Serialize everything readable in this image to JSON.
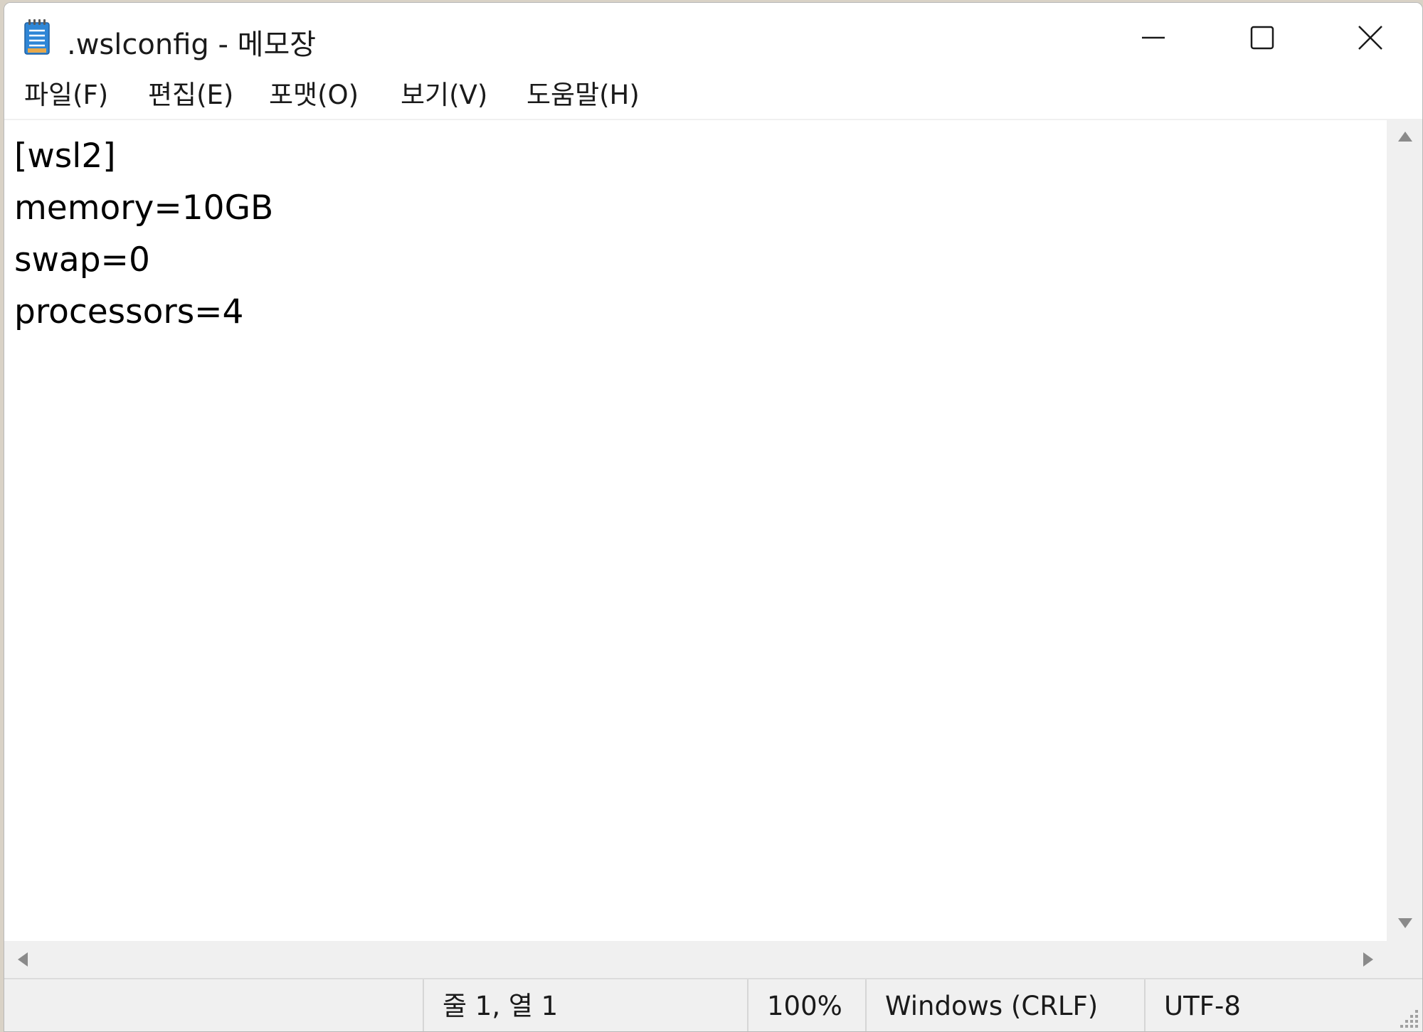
{
  "window": {
    "title": ".wslconfig - 메모장",
    "controls": {
      "minimize_icon": "minimize-icon",
      "maximize_icon": "maximize-icon",
      "close_icon": "close-icon"
    }
  },
  "menu": {
    "items": [
      {
        "label": "파일(F)"
      },
      {
        "label": "편집(E)"
      },
      {
        "label": "포맷(O)"
      },
      {
        "label": "보기(V)"
      },
      {
        "label": "도움말(H)"
      }
    ]
  },
  "editor": {
    "lines": [
      "[wsl2]",
      "memory=10GB",
      "swap=0",
      "processors=4"
    ]
  },
  "status": {
    "position": "줄 1, 열 1",
    "zoom": "100%",
    "line_ending": "Windows (CRLF)",
    "encoding": "UTF-8"
  },
  "colors": {
    "icon_blue": "#3a8ee6",
    "chrome_gray": "#f0f0f0"
  }
}
